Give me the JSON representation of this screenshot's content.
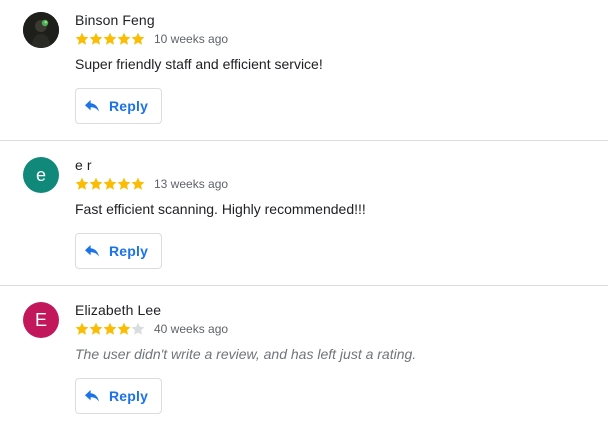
{
  "colors": {
    "star_filled": "#fbbc04",
    "star_empty": "#dadce0",
    "accent": "#1a73e8"
  },
  "reviews": [
    {
      "author": "Binson Feng",
      "avatar_initial": "",
      "avatar_kind": "photo",
      "avatar_color": "#1e1f1b",
      "rating": 5,
      "time": "10 weeks ago",
      "text": "Super friendly staff and efficient service!",
      "reply_label": "Reply"
    },
    {
      "author": "e r",
      "avatar_initial": "e",
      "avatar_kind": "initial",
      "avatar_color": "#11897a",
      "rating": 5,
      "time": "13 weeks ago",
      "text": "Fast efficient scanning. Highly recommended!!!",
      "reply_label": "Reply"
    },
    {
      "author": "Elizabeth Lee",
      "avatar_initial": "E",
      "avatar_kind": "initial",
      "avatar_color": "#c2185b",
      "rating": 4,
      "time": "40 weeks ago",
      "text": "The user didn't write a review, and has left just a rating.",
      "reply_label": "Reply"
    }
  ]
}
